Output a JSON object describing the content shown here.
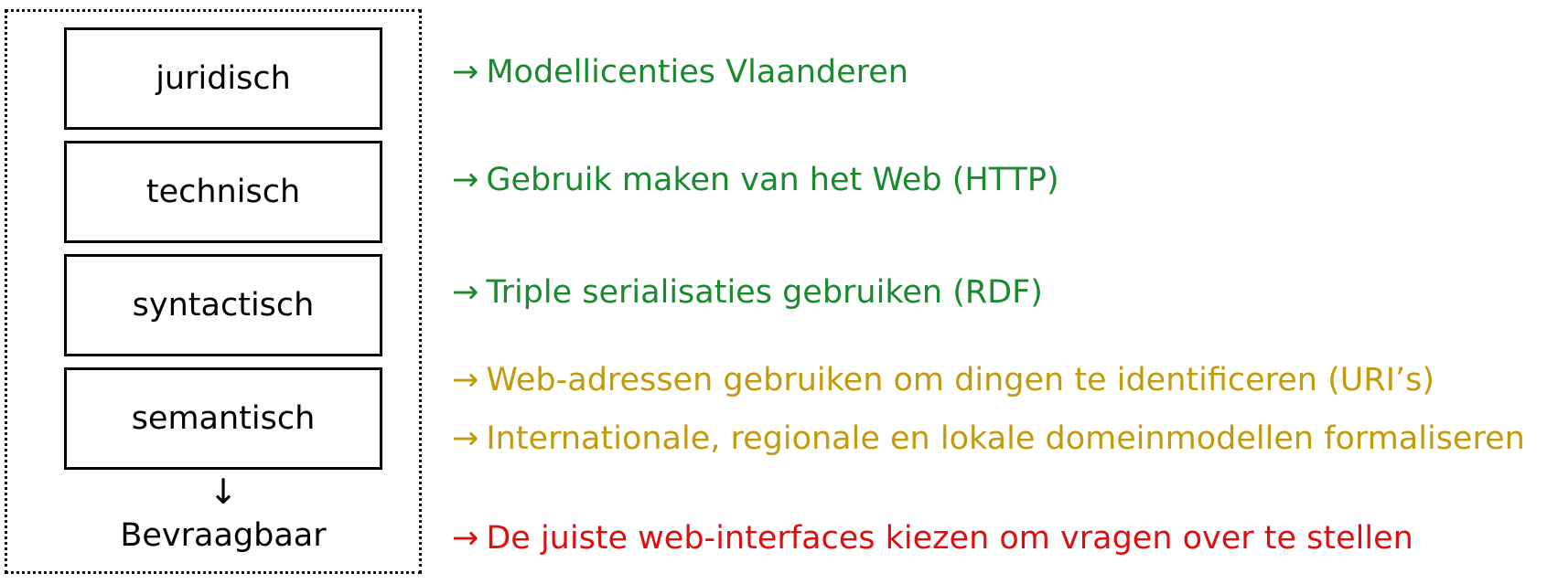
{
  "layers": [
    {
      "label": "juridisch"
    },
    {
      "label": "technisch"
    },
    {
      "label": "syntactisch"
    },
    {
      "label": "semantisch"
    }
  ],
  "down_arrow": "↓",
  "result_label": "Bevraagbaar",
  "items": [
    {
      "arrow": "→",
      "text": "Modellicenties Vlaanderen",
      "color": "#1a8a2e"
    },
    {
      "arrow": "→",
      "text": "Gebruik maken van het Web (HTTP)",
      "color": "#1a8a2e"
    },
    {
      "arrow": "→",
      "text": "Triple serialisaties gebruiken (RDF)",
      "color": "#1a8a2e"
    },
    {
      "arrow": "→",
      "text": "Web-adressen gebruiken om dingen te identificeren (URI’s)",
      "color": "#c29a0e"
    },
    {
      "arrow": "→",
      "text": "Internationale, regionale en lokale domeinmodellen formaliseren",
      "color": "#c29a0e"
    },
    {
      "arrow": "→",
      "text": "De juiste web-interfaces kiezen om vragen over te stellen",
      "color": "#e00f0f"
    }
  ]
}
